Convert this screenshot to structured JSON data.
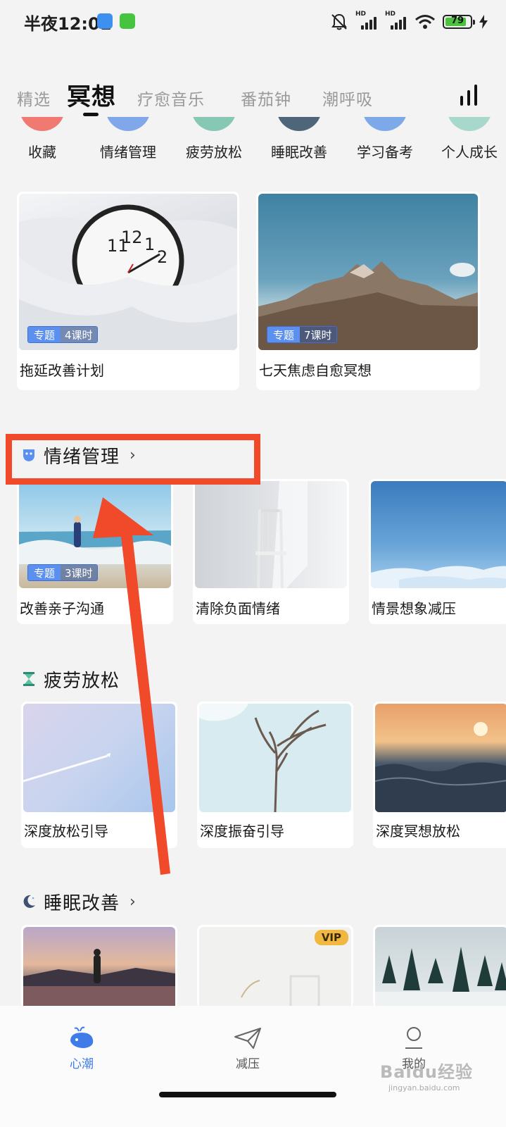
{
  "status_bar": {
    "time": "半夜12:01",
    "battery": "79"
  },
  "tabs": [
    {
      "label": "精选"
    },
    {
      "label": "冥想"
    },
    {
      "label": "疗愈音乐"
    },
    {
      "label": "番茄钟"
    },
    {
      "label": "潮呼吸"
    }
  ],
  "categories": [
    {
      "label": "收藏",
      "color": "#f07a72"
    },
    {
      "label": "情绪管理",
      "color": "#7fa7ea"
    },
    {
      "label": "疲劳放松",
      "color": "#86c8b3"
    },
    {
      "label": "睡眠改善",
      "color": "#4f6579"
    },
    {
      "label": "学习备考",
      "color": "#7ea9e8"
    },
    {
      "label": "个人成长",
      "color": "#a7d8cb"
    }
  ],
  "featured": [
    {
      "title": "拖延改善计划",
      "badge_type": "专题",
      "badge_count": "4课时"
    },
    {
      "title": "七天焦虑自愈冥想",
      "badge_type": "专题",
      "badge_count": "7课时"
    }
  ],
  "sections": {
    "emotion": {
      "title": "情绪管理",
      "chevron": "›",
      "items": [
        {
          "title": "改善亲子沟通",
          "badge_type": "专题",
          "badge_count": "3课时"
        },
        {
          "title": "清除负面情绪"
        },
        {
          "title": "情景想象减压"
        }
      ]
    },
    "fatigue": {
      "title": "疲劳放松",
      "items": [
        {
          "title": "深度放松引导"
        },
        {
          "title": "深度振奋引导"
        },
        {
          "title": "深度冥想放松"
        }
      ]
    },
    "sleep": {
      "title": "睡眠改善",
      "chevron": "›",
      "vip": "VIP"
    }
  },
  "bottom_nav": [
    {
      "label": "心潮",
      "active": true
    },
    {
      "label": "减压",
      "active": false
    },
    {
      "label": "我的",
      "active": false
    }
  ],
  "watermark": {
    "brand": "Baidu经验",
    "url": "jingyan.baidu.com"
  },
  "colors": {
    "accent_blue": "#3f7be9",
    "annotation_red": "#f04a2a"
  }
}
